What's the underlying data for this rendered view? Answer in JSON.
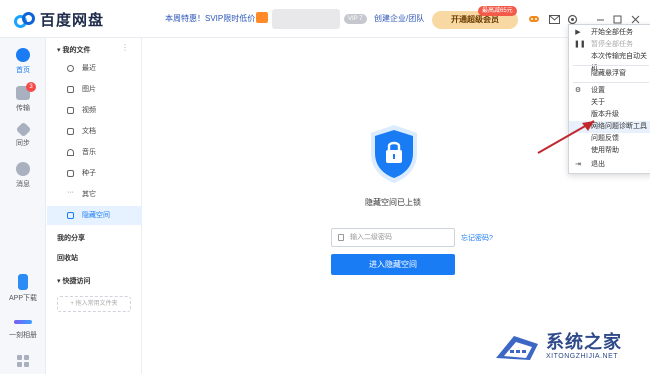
{
  "app": {
    "title": "百度网盘"
  },
  "topbar": {
    "promo_text": "本周特惠！SVIP限时低价",
    "vip_badge": "VIP 7",
    "enterprise_link": "创建企业/团队",
    "member_button": "开通超级会员",
    "member_tag": "最高减65元"
  },
  "nav": {
    "items": [
      {
        "label": "首页",
        "icon": "cloud-icon"
      },
      {
        "label": "传输",
        "icon": "transfer-icon",
        "badge": "3"
      },
      {
        "label": "同步",
        "icon": "sync-icon"
      },
      {
        "label": "消息",
        "icon": "message-icon"
      },
      {
        "label": "APP下载",
        "icon": "phone-icon"
      },
      {
        "label": "一刻相册",
        "icon": "album-icon"
      }
    ]
  },
  "sidebar": {
    "my_files": "我的文件",
    "items": [
      {
        "label": "最近"
      },
      {
        "label": "图片"
      },
      {
        "label": "视频"
      },
      {
        "label": "文档"
      },
      {
        "label": "音乐"
      },
      {
        "label": "种子"
      },
      {
        "label": "其它"
      },
      {
        "label": "隐藏空间"
      }
    ],
    "my_share": "我的分享",
    "recycle": "回收站",
    "quick_access": "快捷访问",
    "add_common": "+ 拖入常用文件夹"
  },
  "main": {
    "locked_text": "隐藏空间已上锁",
    "password_placeholder": "输入二级密码",
    "forgot_link": "忘记密码?",
    "enter_button": "进入隐藏空间"
  },
  "menu": {
    "items": [
      {
        "label": "开始全部任务",
        "state": "normal"
      },
      {
        "label": "暂停全部任务",
        "state": "disabled"
      },
      {
        "label": "本次传输完自动关机",
        "state": "normal"
      },
      {
        "label": "隐藏悬浮窗",
        "state": "normal"
      },
      {
        "label": "设置",
        "state": "normal"
      },
      {
        "label": "关于",
        "state": "normal"
      },
      {
        "label": "版本升级",
        "state": "normal"
      },
      {
        "label": "网络问题诊断工具",
        "state": "hover"
      },
      {
        "label": "问题反馈",
        "state": "normal"
      },
      {
        "label": "使用帮助",
        "state": "normal"
      },
      {
        "label": "退出",
        "state": "normal"
      }
    ]
  },
  "watermark": {
    "title": "系统之家",
    "subtitle": "XITONGZHIJIA.NET"
  },
  "colors": {
    "accent": "#1a7cf5",
    "annotation_arrow": "#c0282d"
  }
}
